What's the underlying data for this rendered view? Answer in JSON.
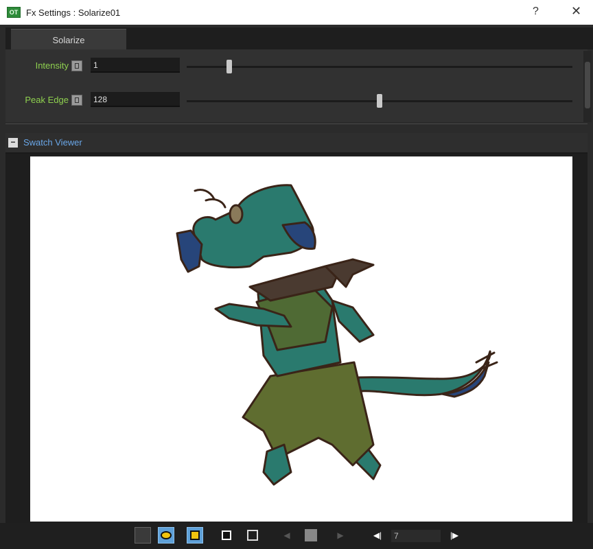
{
  "window": {
    "title": "Fx Settings : Solarize01",
    "app_icon_text": "OT",
    "help_label": "?",
    "close_label": "✕"
  },
  "tabs": [
    {
      "label": "Solarize"
    }
  ],
  "params": [
    {
      "label": "Intensity",
      "value": "1",
      "slider_fraction": 0.11
    },
    {
      "label": "Peak Edge",
      "value": "128",
      "slider_fraction": 0.5
    }
  ],
  "swatch_viewer": {
    "collapse_label": "−",
    "label": "Swatch Viewer"
  },
  "toolbar": {
    "prev_key_label": "◀",
    "next_key_label": "▶",
    "prev_frame_label": "◀|",
    "next_frame_label": "|▶",
    "frame_value": "7"
  },
  "colors": {
    "param_label": "#8fd14f",
    "swatch_label": "#6aa7e8",
    "toggle_on": "#5ea0d8",
    "character_teal": "#2a7a6e",
    "character_olive": "#5f6d30",
    "character_navy": "#27457a"
  }
}
